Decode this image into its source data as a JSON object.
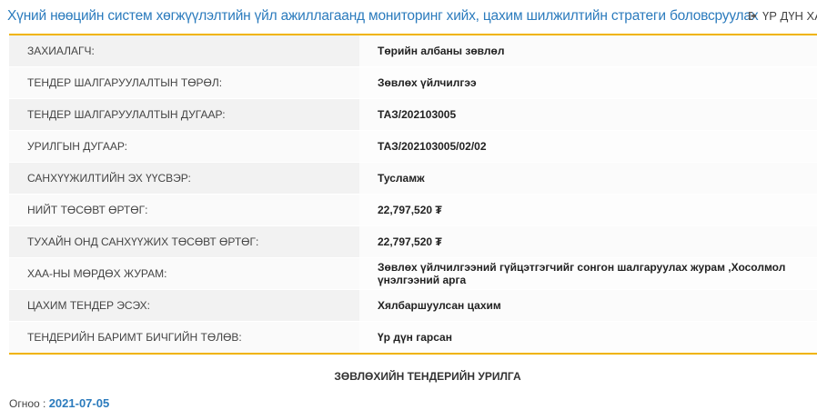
{
  "header": {
    "title": "Хүний нөөцийн систем хөгжүүлэлтийн үйл ажиллагаанд мониторинг хийх, цахим шилжилтийн стратеги боловсруулах",
    "result_link": "ҮР ДҮН ХА"
  },
  "details": [
    {
      "label": "ЗАХИАЛАГЧ:",
      "value": "Төрийн албаны зөвлөл"
    },
    {
      "label": "ТЕНДЕР ШАЛГАРУУЛАЛТЫН ТӨРӨЛ:",
      "value": "Зөвлөх үйлчилгээ"
    },
    {
      "label": "ТЕНДЕР ШАЛГАРУУЛАЛТЫН ДУГААР:",
      "value": "ТАЗ/202103005"
    },
    {
      "label": "УРИЛГЫН ДУГААР:",
      "value": "ТАЗ/202103005/02/02"
    },
    {
      "label": "САНХҮҮЖИЛТИЙН ЭХ ҮҮСВЭР:",
      "value": "Тусламж"
    },
    {
      "label": "НИЙТ ТӨСӨВТ ӨРТӨГ:",
      "value": "22,797,520 ₮"
    },
    {
      "label": "ТУХАЙН ОНД САНХҮҮЖИХ ТӨСӨВТ ӨРТӨГ:",
      "value": "22,797,520 ₮"
    },
    {
      "label": "ХАА-НЫ МӨРДӨХ ЖУРАМ:",
      "value": "Зөвлөх үйлчилгээний гүйцэтгэгчийг сонгон шалгаруулах журам ,Хосолмол үнэлгээний арга"
    },
    {
      "label": "ЦАХИМ ТЕНДЕР ЭСЭХ:",
      "value": "Хялбаршуулсан цахим"
    },
    {
      "label": "ТЕНДЕРИЙН БАРИМТ БИЧГИЙН ТӨЛӨВ:",
      "value": "Үр дүн гарсан"
    }
  ],
  "section": {
    "title": "ЗӨВЛӨХИЙН ТЕНДЕРИЙН УРИЛГА",
    "date_label": "Огноо :",
    "date_value": "2021-07-05"
  },
  "colors": {
    "accent_border": "#f0b400",
    "title_blue": "#2b7bbd"
  },
  "icons": {
    "result_link": "sign-out-icon"
  }
}
